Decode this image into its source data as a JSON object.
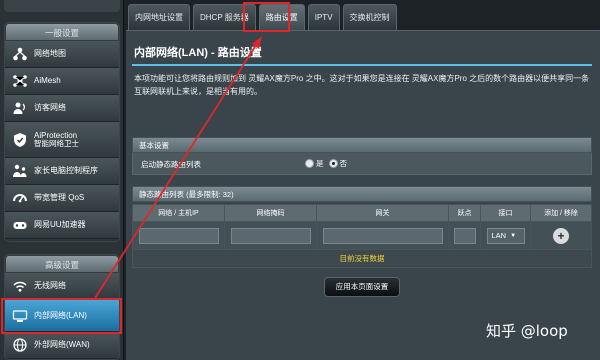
{
  "sidebar": {
    "section1_title": "一般设置",
    "section2_title": "高级设置",
    "items": [
      {
        "label": "网络地图",
        "icon": "network-map-icon"
      },
      {
        "label": "AiMesh",
        "icon": "aimesh-icon"
      },
      {
        "label": "访客网络",
        "icon": "guest-network-icon"
      },
      {
        "label": "AiProtection",
        "label2": "智能网络卫士",
        "icon": "aiprotection-icon"
      },
      {
        "label": "家长电脑控制程序",
        "icon": "parental-control-icon"
      },
      {
        "label": "带宽管理 QoS",
        "icon": "qos-icon"
      },
      {
        "label": "网易UU加速器",
        "icon": "uu-accelerator-icon"
      }
    ],
    "advanced_items": [
      {
        "label": "无线网络",
        "icon": "wireless-icon"
      },
      {
        "label": "内部网络(LAN)",
        "icon": "lan-icon",
        "active": true
      },
      {
        "label": "外部网络(WAN)",
        "icon": "wan-icon"
      }
    ]
  },
  "tabs": [
    {
      "label": "内网地址设置"
    },
    {
      "label": "DHCP 服务器"
    },
    {
      "label": "路由设置",
      "active": true
    },
    {
      "label": "IPTV"
    },
    {
      "label": "交换机控制"
    }
  ],
  "main": {
    "title": "内部网络(LAN) - 路由设置",
    "description": "本项功能可让您将路由规则加到 灵耀AX魔方Pro 之中。这对于如果您是连接在 灵耀AX魔方Pro 之后的数个路由器以便共享同一条互联网联机上来说，是相当有用的。",
    "basic_section": "基本设置",
    "static_route_label": "启动静态路由列表",
    "radio_yes": "是",
    "radio_no": "否",
    "radio_selected": "否",
    "table_title": "静态路由列表 (最多限制: 32)",
    "columns": [
      "网络 / 主机IP",
      "网络掩码",
      "网关",
      "跃点",
      "接口",
      "添加 / 移除"
    ],
    "interface_value": "LAN",
    "empty_text": "目前没有数据",
    "apply_label": "应用本页面设置"
  },
  "watermark": "知乎 @loop",
  "colors": {
    "highlight": "#e0262b",
    "accent": "#5dc2e6",
    "empty_text": "#f3d233"
  }
}
